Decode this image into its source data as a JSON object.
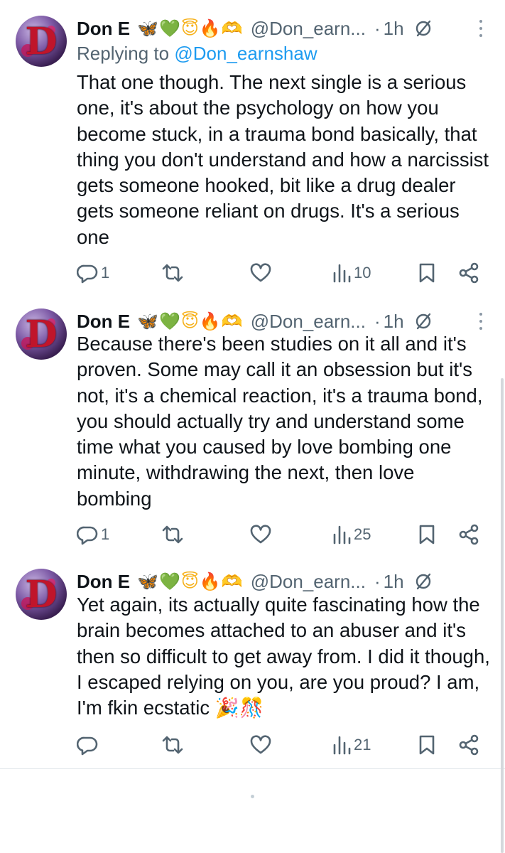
{
  "tweets": [
    {
      "author_name": "Don E",
      "emojis": [
        "🦋",
        "💚",
        "😇",
        "🔥",
        "🫶"
      ],
      "handle": "@Don_earn...",
      "dot": "·",
      "time": "1h",
      "replying_prefix": "Replying to",
      "replying_handle": "@Don_earnshaw",
      "text": "That one though. The next single is a serious one, it's about the psychology on how you become stuck, in a trauma bond basically, that thing you don't understand and how a narcissist gets someone hooked, bit like a drug dealer gets someone reliant on drugs. It's a serious one",
      "replies": "1",
      "retweets": "",
      "likes": "",
      "views": "10"
    },
    {
      "author_name": "Don E",
      "emojis": [
        "🦋",
        "💚",
        "😇",
        "🔥",
        "🫶"
      ],
      "handle": "@Don_earn...",
      "dot": "·",
      "time": "1h",
      "text": "Because there's been studies on it all and it's proven. Some may call it an obsession but it's not, it's a chemical reaction, it's a trauma bond, you should actually try and understand some time what you caused by love bombing one minute, withdrawing the next, then love bombing",
      "replies": "1",
      "retweets": "",
      "likes": "",
      "views": "25"
    },
    {
      "author_name": "Don E",
      "emojis": [
        "🦋",
        "💚",
        "😇",
        "🔥",
        "🫶"
      ],
      "handle": "@Don_earn...",
      "dot": "·",
      "time": "1h",
      "text": "Yet again, its actually quite fascinating how the brain becomes attached to an abuser and it's then so difficult to get away from. I did it though, I escaped relying on you, are you proud? I am, I'm fkin ecstatic 🎉🎊",
      "replies": "",
      "retweets": "",
      "likes": "",
      "views": "21"
    }
  ],
  "icons": {
    "reply": "reply-icon",
    "retweet": "retweet-icon",
    "like": "heart-icon",
    "views": "views-icon",
    "bookmark": "bookmark-icon",
    "share": "share-icon",
    "grok": "grok-icon",
    "more": "more-icon"
  },
  "colors": {
    "text": "#0f1419",
    "secondary": "#536471",
    "link": "#1d9bf0",
    "divider": "#e1e6ea"
  }
}
